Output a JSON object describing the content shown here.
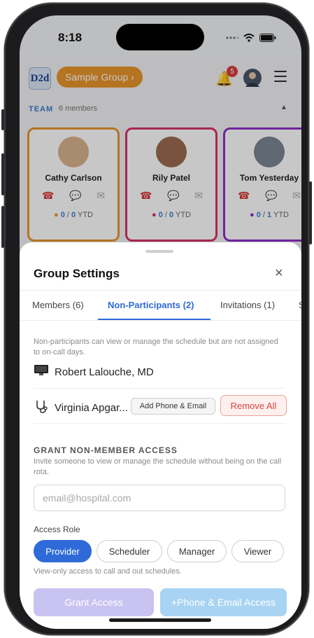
{
  "status": {
    "time": "8:18"
  },
  "header": {
    "logo_text": "D2d",
    "group_label": "Sample Group ›",
    "notification_count": "5"
  },
  "team": {
    "label": "TEAM",
    "count": "6 members",
    "caret": "▲",
    "members": [
      {
        "name": "Cathy Carlson",
        "color": "#e8952b",
        "dot": "#e8952b",
        "done": "0",
        "total": "0",
        "ytd": "YTD"
      },
      {
        "name": "Rily Patel",
        "color": "#d6336c",
        "dot": "#d6336c",
        "done": "0",
        "total": "0",
        "ytd": "YTD"
      },
      {
        "name": "Tom Yesterday",
        "color": "#8e2fc9",
        "dot": "#8e2fc9",
        "done": "0",
        "total": "1",
        "ytd": "YTD"
      }
    ]
  },
  "sheet": {
    "title": "Group Settings",
    "close_icon": "×",
    "tabs": [
      {
        "label": "Members (6)"
      },
      {
        "label": "Non-Participants (2)"
      },
      {
        "label": "Invitations (1)"
      },
      {
        "label": "S"
      }
    ],
    "description": "Non-participants can view or manage the schedule but are not assigned to on-call days.",
    "non_participants": [
      {
        "name": "Robert Lalouche, MD",
        "icon": "monitor-icon"
      },
      {
        "name": "Virginia Apgar...",
        "icon": "stethoscope-icon"
      }
    ],
    "add_phone_label": "Add Phone & Email",
    "remove_all_label": "Remove All",
    "grant_heading": "GRANT NON-MEMBER ACCESS",
    "grant_sub": "Invite someone to view or manage the schedule without being on the call rota.",
    "email_placeholder": "email@hospital.com",
    "access_role_label": "Access Role",
    "roles": [
      "Provider",
      "Scheduler",
      "Manager",
      "Viewer"
    ],
    "selected_role": "Provider",
    "role_hint": "View-only access to call and out schedules.",
    "grant_button": "Grant Access",
    "phone_button": "+Phone & Email Access"
  }
}
